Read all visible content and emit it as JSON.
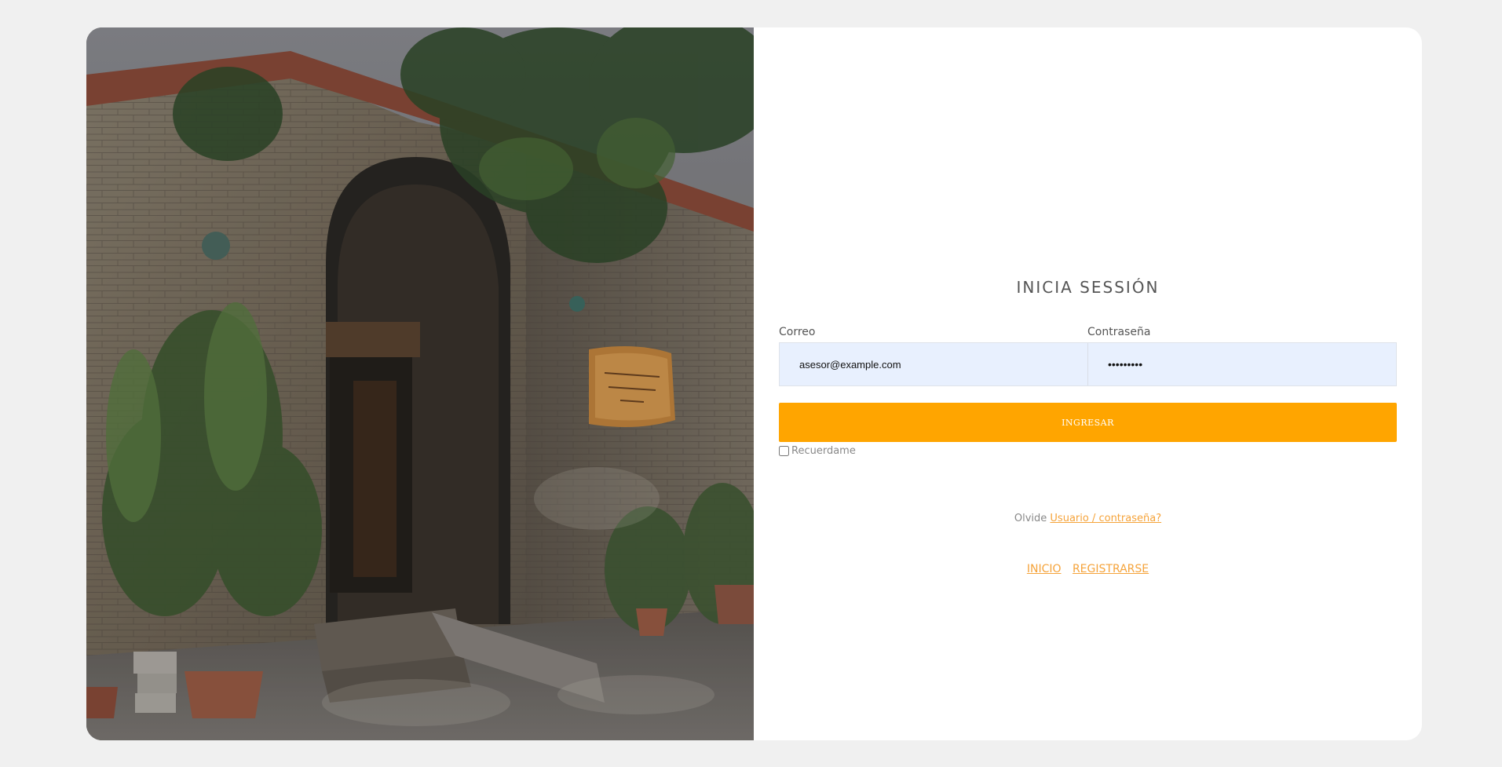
{
  "login": {
    "title": "INICIA SESSIÓN",
    "email_label": "Correo",
    "email_value": "asesor@example.com",
    "password_label": "Contraseña",
    "password_value": "•••••••••",
    "submit_label": "INGRESAR",
    "remember_label": "Recuerdame",
    "forgot_prefix": "Olvide",
    "forgot_link": "Usuario / contraseña?"
  },
  "footer_links": {
    "inicio": "INICIO",
    "registrarse": "REGISTRARSE"
  },
  "colors": {
    "accent": "#ffa500",
    "link": "#f5a33a",
    "input_bg": "#e8f0fe",
    "page_bg": "#f0f0f0"
  }
}
